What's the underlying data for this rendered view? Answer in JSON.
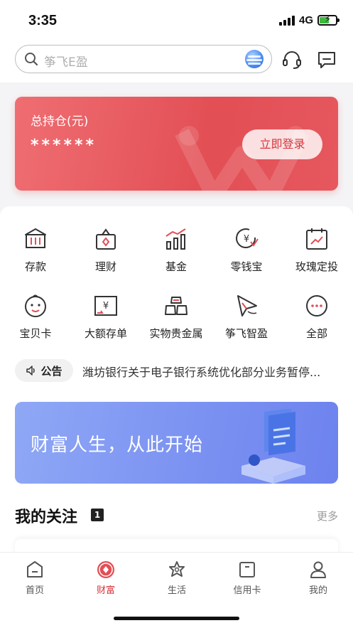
{
  "status_bar": {
    "time": "3:35",
    "network": "4G"
  },
  "header": {
    "search_placeholder": "筝飞E盈",
    "icons": [
      "search-icon",
      "voice-assistant-icon",
      "customer-service-icon",
      "message-icon"
    ]
  },
  "asset_card": {
    "label": "总持仓(元)",
    "value": "******",
    "login_button": "立即登录"
  },
  "shortcuts": [
    {
      "label": "存款",
      "icon": "bank-icon"
    },
    {
      "label": "理财",
      "icon": "wealth-bag-icon"
    },
    {
      "label": "基金",
      "icon": "fund-chart-icon"
    },
    {
      "label": "零钱宝",
      "icon": "yuan-coin-icon"
    },
    {
      "label": "玫瑰定投",
      "icon": "calendar-trend-icon"
    },
    {
      "label": "宝贝卡",
      "icon": "baby-face-icon"
    },
    {
      "label": "大额存单",
      "icon": "large-deposit-icon"
    },
    {
      "label": "实物贵金属",
      "icon": "gold-bars-icon"
    },
    {
      "label": "筝飞智盈",
      "icon": "kite-icon"
    },
    {
      "label": "全部",
      "icon": "more-icon"
    }
  ],
  "notice": {
    "tag": "公告",
    "text": "潍坊银行关于电子银行系统优化部分业务暂停..."
  },
  "banner": {
    "text": "财富人生，从此开始"
  },
  "follow_section": {
    "title": "我的关注",
    "badge": "1",
    "more": "更多"
  },
  "tabbar": {
    "tabs": [
      {
        "label": "首页",
        "icon": "home-icon",
        "active": false
      },
      {
        "label": "财富",
        "icon": "wealth-icon",
        "active": true
      },
      {
        "label": "生活",
        "icon": "life-icon",
        "active": false
      },
      {
        "label": "信用卡",
        "icon": "credit-card-icon",
        "active": false
      },
      {
        "label": "我的",
        "icon": "profile-icon",
        "active": false
      }
    ]
  },
  "colors": {
    "primary_red": "#e24f55",
    "active_tab": "#d8353c",
    "banner_blue": "#7d94f2"
  }
}
